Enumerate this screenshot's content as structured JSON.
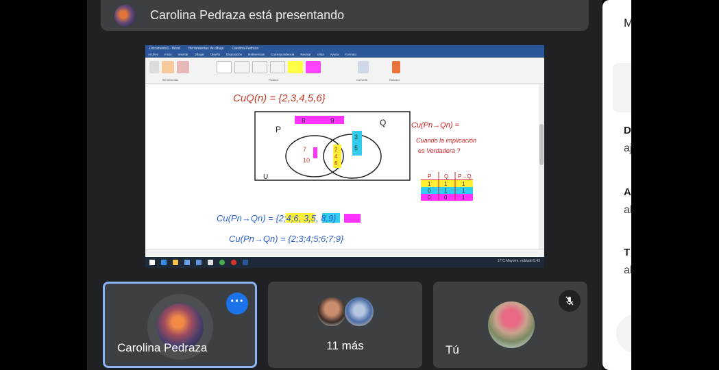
{
  "banner": {
    "text": "Carolina Pedraza está presentando",
    "avatar_icon": "avatar-icon"
  },
  "screen": {
    "titlebar_items": [
      "Documento1 - Word",
      "Herramientas de dibujo",
      "Carolina Pedraza"
    ],
    "tabs": [
      "Archivo",
      "Inicio",
      "Insertar",
      "Dibujar",
      "Diseño",
      "Disposición",
      "Referencias",
      "Correspondencia",
      "Revisar",
      "Vista",
      "Ayuda",
      "Formato"
    ],
    "ribbon_labels": [
      "Herramientas",
      "Plumas",
      "Convertir",
      "Rehacer"
    ],
    "notes": {
      "line1": "CuQ(n) = {2,3,4,5,6}",
      "set_p": "P",
      "set_q": "Q",
      "universe": "U",
      "venn_left": [
        "7",
        "10"
      ],
      "venn_mid": [
        "2",
        "4",
        "6"
      ],
      "venn_right": [
        "3",
        "5"
      ],
      "top_box": [
        "8",
        "9"
      ],
      "red_title": "Cu(Pn→Qn) =",
      "red_text1": "Cuando la implicación",
      "red_text2": "es Verdadera ?",
      "truth_headers": [
        "P",
        "Q",
        "P→Q"
      ],
      "truth_rows": [
        [
          "1",
          "1",
          "1"
        ],
        [
          "0",
          "1",
          "1"
        ],
        [
          "0",
          "0",
          "1"
        ]
      ],
      "blue_line1": "Cu(Pn→Qn) = {2;4;6, 3,5, 8,9}",
      "blue_line2": "Cu(Pn→Qn) = {2;3;4;5;6;7;9}"
    },
    "taskbar_right": "17°C Mayorm. nublado   5:43"
  },
  "tiles": {
    "presenter_name": "Carolina Pedraza",
    "more_label": "11 más",
    "self_name": "Tú"
  },
  "panel": {
    "title": "M",
    "items": [
      {
        "bold": "D",
        "sub": "aj"
      },
      {
        "bold": "A",
        "sub": "al"
      },
      {
        "bold": "T",
        "sub": "al"
      }
    ]
  },
  "colors": {
    "accent": "#1a73e8",
    "tile_bg": "#3c4043",
    "stage_bg": "#202124",
    "highlight_border": "#8ab4f8"
  }
}
